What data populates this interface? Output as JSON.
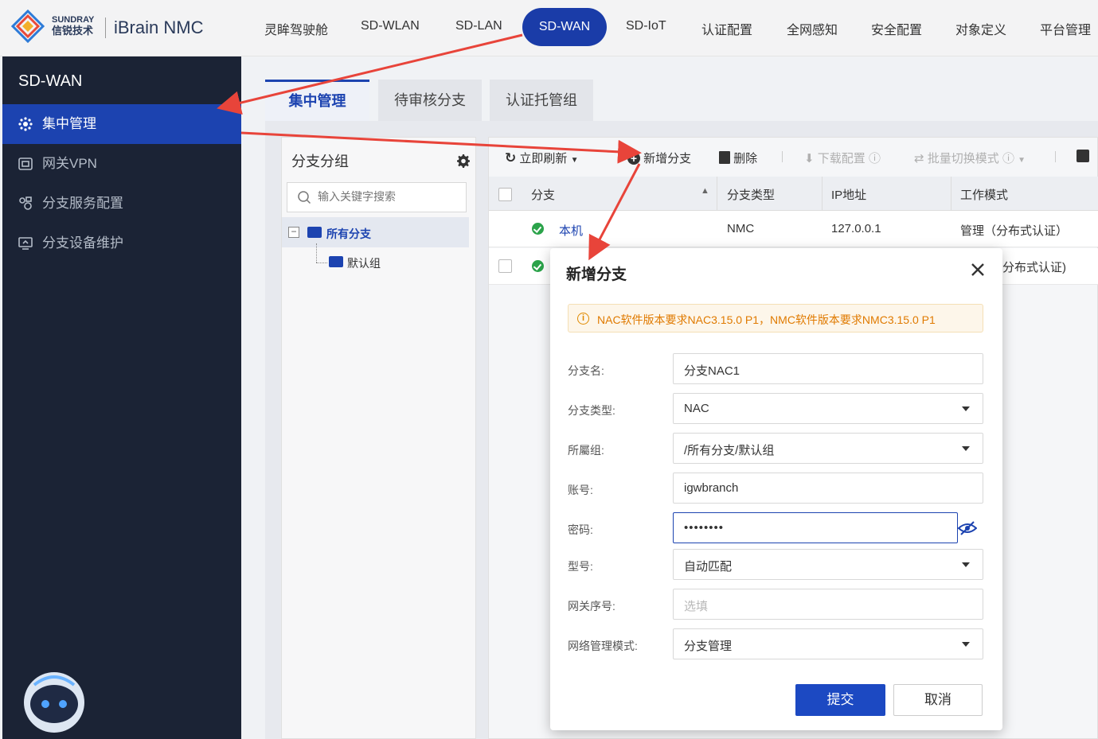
{
  "brand": {
    "en": "SUNDRAY",
    "cn": "信锐技术",
    "product": "iBrain NMC"
  },
  "nav": {
    "items": [
      "灵眸驾驶舱",
      "SD-WLAN",
      "SD-LAN",
      "SD-WAN",
      "SD-IoT",
      "认证配置",
      "全网感知",
      "安全配置",
      "对象定义",
      "平台管理"
    ],
    "active": "SD-WAN"
  },
  "sidebar": {
    "title": "SD-WAN",
    "items": [
      "集中管理",
      "网关VPN",
      "分支服务配置",
      "分支设备维护"
    ]
  },
  "tabs": [
    "集中管理",
    "待审核分支",
    "认证托管组"
  ],
  "group_panel": {
    "title": "分支分组",
    "search_placeholder": "输入关键字搜索",
    "tree": {
      "root": "所有分支",
      "child": "默认组"
    }
  },
  "toolbar": {
    "refresh": "立即刷新",
    "add": "新增分支",
    "delete": "删除",
    "download": "下载配置",
    "batch": "批量切换模式"
  },
  "table": {
    "headers": [
      "分支",
      "分支类型",
      "IP地址",
      "工作模式"
    ],
    "rows": [
      {
        "name": "本机",
        "type": "NMC",
        "ip": "127.0.0.1",
        "mode": "管理（分布式认证）"
      },
      {
        "mode_partial": "分布式认证)"
      }
    ]
  },
  "modal": {
    "title": "新增分支",
    "notice": "NAC软件版本要求NAC3.15.0 P1，NMC软件版本要求NMC3.15.0 P1",
    "fields": {
      "branch_name": {
        "label": "分支名:",
        "value": "分支NAC1"
      },
      "branch_type": {
        "label": "分支类型:",
        "value": "NAC"
      },
      "group": {
        "label": "所屬组:",
        "value": "/所有分支/默认组"
      },
      "account": {
        "label": "账号:",
        "value": "igwbranch"
      },
      "password": {
        "label": "密码:",
        "value": "••••••••"
      },
      "model": {
        "label": "型号:",
        "value": "自动匹配"
      },
      "gateway_no": {
        "label": "网关序号:",
        "placeholder": "选填"
      },
      "mgmt_mode": {
        "label": "网络管理模式:",
        "value": "分支管理"
      }
    },
    "submit": "提交",
    "cancel": "取消"
  },
  "colors": {
    "accent": "#1c43b0",
    "sidebar_bg": "#1b2335",
    "warning": "#e07a00",
    "ok": "#2ba34a",
    "arrow": "#e8443a"
  }
}
